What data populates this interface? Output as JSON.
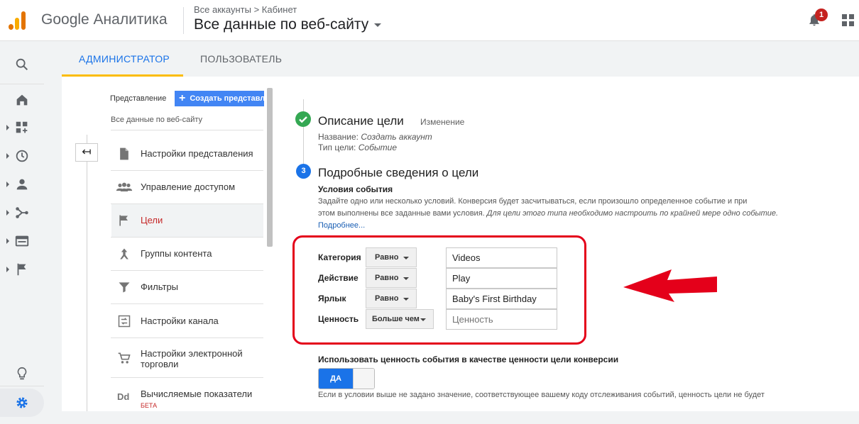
{
  "app": {
    "brand": "Google Аналитика",
    "breadcrumbs": "Все аккаунты > Кабинет",
    "view_title": "Все данные по веб-сайту",
    "notifications_count": "1"
  },
  "tabs": [
    {
      "label": "АДМИНИСТРАТОР",
      "active": true
    },
    {
      "label": "ПОЛЬЗОВАТЕЛЬ",
      "active": false
    }
  ],
  "view_column": {
    "label": "Представление",
    "create_button": "Создать представл",
    "current_view": "Все данные по веб-сайту",
    "back_icon": "↤",
    "items": [
      {
        "label": "Настройки представления",
        "icon": "document-icon"
      },
      {
        "label": "Управление доступом",
        "icon": "people-icon"
      },
      {
        "label": "Цели",
        "icon": "flag-icon",
        "active": true
      },
      {
        "label": "Группы контента",
        "icon": "group-content-icon"
      },
      {
        "label": "Фильтры",
        "icon": "filter-icon"
      },
      {
        "label": "Настройки канала",
        "icon": "channel-icon"
      },
      {
        "label": "Настройки электронной торговли",
        "icon": "cart-icon"
      },
      {
        "label": "Вычисляемые показатели",
        "icon": "dd-icon",
        "badge": "БЕТА"
      }
    ]
  },
  "goal": {
    "step1": {
      "title": "Описание цели",
      "action": "Изменение",
      "name_label": "Название:",
      "name_value": "Создать аккаунт",
      "type_label": "Тип цели:",
      "type_value": "Событие"
    },
    "step2": {
      "number": "3",
      "title": "Подробные сведения о цели",
      "subtitle": "Условия события",
      "desc_line1": "Задайте одно или несколько условий. Конверсия будет засчитываться, если произошло определенное событие и при",
      "desc_line2_plain": "этом выполнены все заданные вами условия.",
      "desc_line2_italic": " Для цели этого типа необходимо настроить по крайней мере одно событие.",
      "more_link": "Подробнее..."
    },
    "conditions": [
      {
        "label": "Категория",
        "operator": "Равно",
        "value": "Videos",
        "placeholder": ""
      },
      {
        "label": "Действие",
        "operator": "Равно",
        "value": "Play",
        "placeholder": ""
      },
      {
        "label": "Ярлык",
        "operator": "Равно",
        "value": "Baby's First Birthday",
        "placeholder": ""
      },
      {
        "label": "Ценность",
        "operator": "Больше чем",
        "value": "",
        "placeholder": "Ценность"
      }
    ],
    "use_value_label": "Использовать ценность события в качестве ценности цели конверсии",
    "toggle_label": "ДА",
    "footnote": "Если в условии выше не задано значение, соответствующее вашему коду отслеживания событий, ценность цели не будет"
  },
  "colors": {
    "accent_blue": "#1a73e8",
    "tab_underline": "#fbbc04",
    "highlight_red": "#e4001a",
    "success_green": "#34a853"
  }
}
